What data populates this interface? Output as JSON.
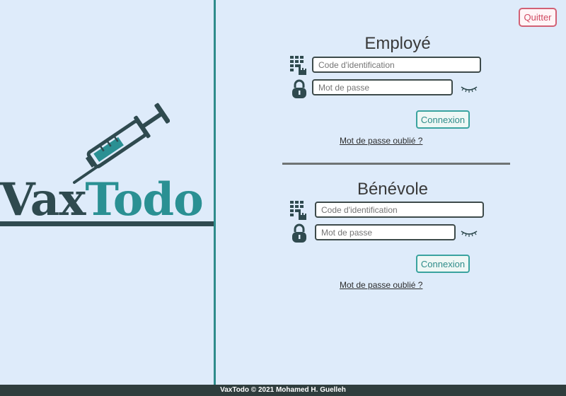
{
  "logo": {
    "part1": "Vax",
    "part2": "Todo"
  },
  "toolbar": {
    "quit_label": "Quitter"
  },
  "employe": {
    "title": "Employé",
    "id_placeholder": "Code d'identification",
    "password_placeholder": "Mot de passe",
    "connect_label": "Connexion",
    "forgot_label": "Mot de passe oublié ?"
  },
  "benevole": {
    "title": "Bénévole",
    "id_placeholder": "Code d'identification",
    "password_placeholder": "Mot de passe",
    "connect_label": "Connexion",
    "forgot_label": "Mot de passe oublié ?"
  },
  "footer": {
    "text": "VaxTodo © 2021 Mohamed H. Guelleh"
  },
  "icons": {
    "keypad": "keypad-icon",
    "lock": "lock-icon",
    "eye": "eye-closed-icon",
    "syringe": "syringe-icon"
  },
  "colors": {
    "background": "#deebfa",
    "accent": "#2a9093",
    "dark": "#2f4a4f",
    "quit": "#d04a62"
  }
}
